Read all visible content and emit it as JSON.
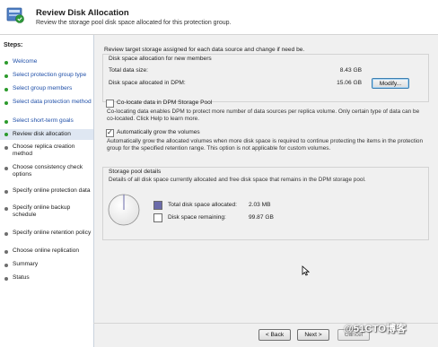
{
  "header": {
    "title": "Review Disk Allocation",
    "subtitle": "Review the storage pool disk space allocated for this protection group."
  },
  "sidebar": {
    "title": "Steps:",
    "items": [
      {
        "label": "Welcome",
        "state": "done"
      },
      {
        "label": "Select protection group type",
        "state": "done"
      },
      {
        "label": "Select group members",
        "state": "done"
      },
      {
        "label": "Select data protection method",
        "state": "done"
      },
      {
        "label": "Select short-term goals",
        "state": "done"
      },
      {
        "label": "Review disk allocation",
        "state": "current"
      },
      {
        "label": "Choose replica creation method",
        "state": "todo"
      },
      {
        "label": "Choose consistency check options",
        "state": "todo"
      },
      {
        "label": "Specify online protection data",
        "state": "todo"
      },
      {
        "label": "Specify online backup schedule",
        "state": "todo"
      },
      {
        "label": "Specify online retention policy",
        "state": "todo"
      },
      {
        "label": "Choose online replication",
        "state": "todo"
      },
      {
        "label": "Summary",
        "state": "todo"
      },
      {
        "label": "Status",
        "state": "todo"
      }
    ]
  },
  "main": {
    "intro": "Review target storage assigned for each data source and change if need be.",
    "allocation": {
      "title": "Disk space allocation for new members",
      "total_label": "Total data size:",
      "total_value": "8.43 GB",
      "allocated_label": "Disk space allocated in DPM:",
      "allocated_value": "15.06 GB",
      "modify_label": "Modify..."
    },
    "colocate": {
      "label": "Co-locate data in DPM Storage Pool",
      "checked": false,
      "desc": "Co-locating data enables DPM to protect more number of data sources per replica volume. Only certain type of data can be co-located. Click Help to learn more."
    },
    "autogrow": {
      "label": "Automatically grow the volumes",
      "checked": true,
      "desc": "Automatically grow the allocated volumes when more disk space is required to continue protecting the items in the protection group for the specified retention range. This option is not applicable for custom volumes."
    },
    "pool": {
      "title": "Storage pool details",
      "desc": "Details of all disk space currently allocated and free disk space that remains in the DPM storage pool.",
      "allocated_label": "Total disk space allocated:",
      "allocated_value": "2.03 MB",
      "remaining_label": "Disk space remaining:",
      "remaining_value": "99.87 GB",
      "allocated_fraction": 2e-05,
      "allocated_color": "#6b6baa",
      "remaining_color": "#ffffff"
    }
  },
  "footer": {
    "back_label": "< Back",
    "next_label": "Next >",
    "cancel_label": "Cancel"
  },
  "watermark": "@51CTO博客"
}
